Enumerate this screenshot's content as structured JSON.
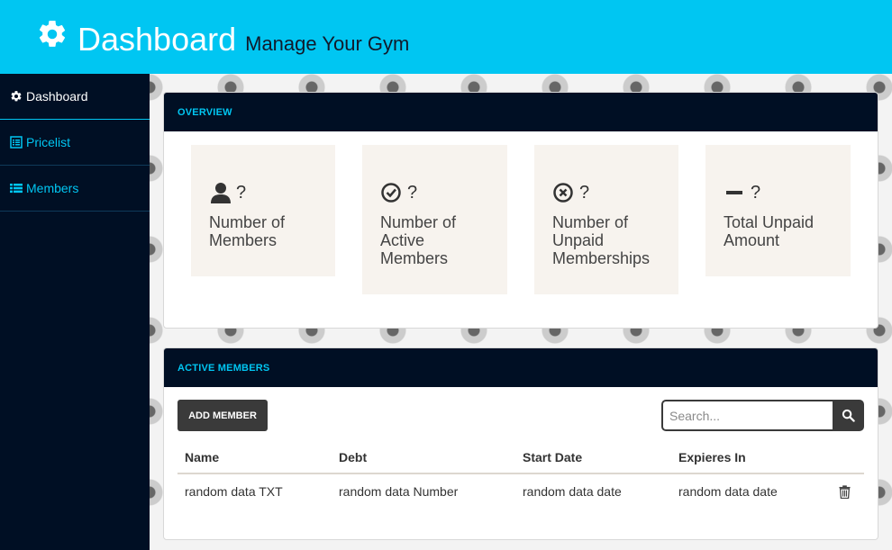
{
  "header": {
    "title": "Dashboard",
    "subtitle": "Manage Your Gym"
  },
  "sidebar": {
    "items": [
      {
        "label": "Dashboard",
        "icon": "gear-icon",
        "active": true
      },
      {
        "label": "Pricelist",
        "icon": "list-alt-icon",
        "active": false
      },
      {
        "label": "Members",
        "icon": "list-icon",
        "active": false
      }
    ]
  },
  "overview": {
    "heading": "OVERVIEW",
    "cards": [
      {
        "icon": "user-icon",
        "value": "?",
        "label": "Number of Members"
      },
      {
        "icon": "check-circle-icon",
        "value": "?",
        "label": "Number of Active Members"
      },
      {
        "icon": "x-circle-icon",
        "value": "?",
        "label": "Number of Unpaid Memberships"
      },
      {
        "icon": "minus-icon",
        "value": "?",
        "label": "Total Unpaid Amount"
      }
    ]
  },
  "active_members": {
    "heading": "ACTIVE MEMBERS",
    "add_label": "ADD MEMBER",
    "search_placeholder": "Search...",
    "columns": [
      "Name",
      "Debt",
      "Start Date",
      "Expieres In"
    ],
    "rows": [
      {
        "name": "random data TXT",
        "debt": "random data Number",
        "start": "random data date",
        "expires": "random data date"
      }
    ]
  },
  "colors": {
    "accent": "#00c6f2",
    "navy": "#000f24",
    "card_bg": "#f7f3ee",
    "button_dark": "#3a3a3a"
  }
}
